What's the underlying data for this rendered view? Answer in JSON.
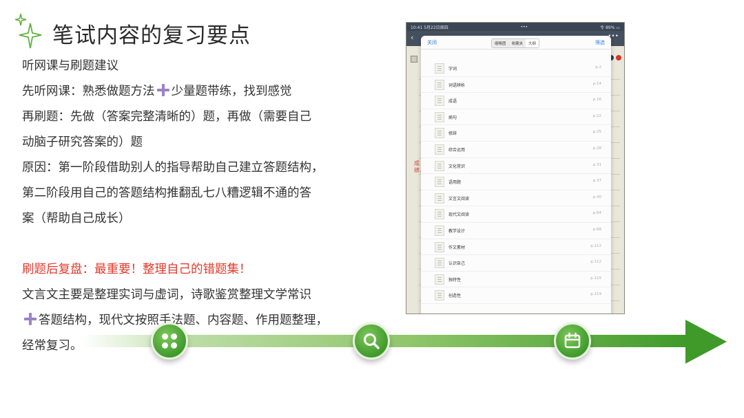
{
  "title": "笔试内容的复习要点",
  "body": {
    "line1": "听网课与刷题建议",
    "line2a": "先听网课：熟悉做题方法",
    "line2b": "少量题带练，找到感觉",
    "line3": "再刷题：先做（答案完整清晰的）题，再做（需要自己",
    "line4": "动脑子研究答案的）题",
    "line5": "原因：第一阶段借助别人的指导帮助自己建立答题结构，",
    "line6": "第二阶段用自己的答题结构推翻乱七八糟逻辑不通的答",
    "line7": "案（帮助自己成长）",
    "line8": "刷题后复盘：最重要！整理自己的错题集！",
    "line9": "文言文主要是整理实词与虚词，诗歌鉴赏整理文学常识",
    "line10": "答题结构，现代文按照手法题、内容题、作用题整理，",
    "line11": "经常复习。"
  },
  "timeline": {
    "nodes": [
      {
        "icon": "grid-icon"
      },
      {
        "icon": "search-icon"
      },
      {
        "icon": "calendar-icon"
      }
    ]
  },
  "screenshot": {
    "status_left": "10:41 5月22日周四",
    "status_center": "•••",
    "status_right": "令 89% ▭",
    "close_label": "关闭",
    "filter_label": "筛选",
    "segments": [
      "缩略图",
      "收藏夹",
      "大纲"
    ],
    "active_segment": "大纲",
    "side_red_text": "成绩…",
    "outline": [
      {
        "label": "字词",
        "page": "p.2"
      },
      {
        "label": "词语辨析",
        "page": "p.14"
      },
      {
        "label": "成语",
        "page": "p.16"
      },
      {
        "label": "病句",
        "page": "p.22"
      },
      {
        "label": "修辞",
        "page": "p.25"
      },
      {
        "label": "综合运用",
        "page": "p.28"
      },
      {
        "label": "文化常识",
        "page": "p.31"
      },
      {
        "label": "语用题",
        "page": "p.37"
      },
      {
        "label": "文言文阅读",
        "page": "p.40"
      },
      {
        "label": "现代文阅读",
        "page": "p.64"
      },
      {
        "label": "教学设计",
        "page": "p.68"
      },
      {
        "label": "作文素材",
        "page": "p.112"
      },
      {
        "label": "认识自己",
        "page": "p.112"
      },
      {
        "label": "独特性",
        "page": "p.115"
      },
      {
        "label": "创造性",
        "page": "p.119"
      }
    ]
  },
  "colors": {
    "accent_green": "#3f9a2a",
    "highlight_red": "#e53a2c",
    "plus_purple": "#9b82c4",
    "link_blue": "#2f7ae5"
  }
}
